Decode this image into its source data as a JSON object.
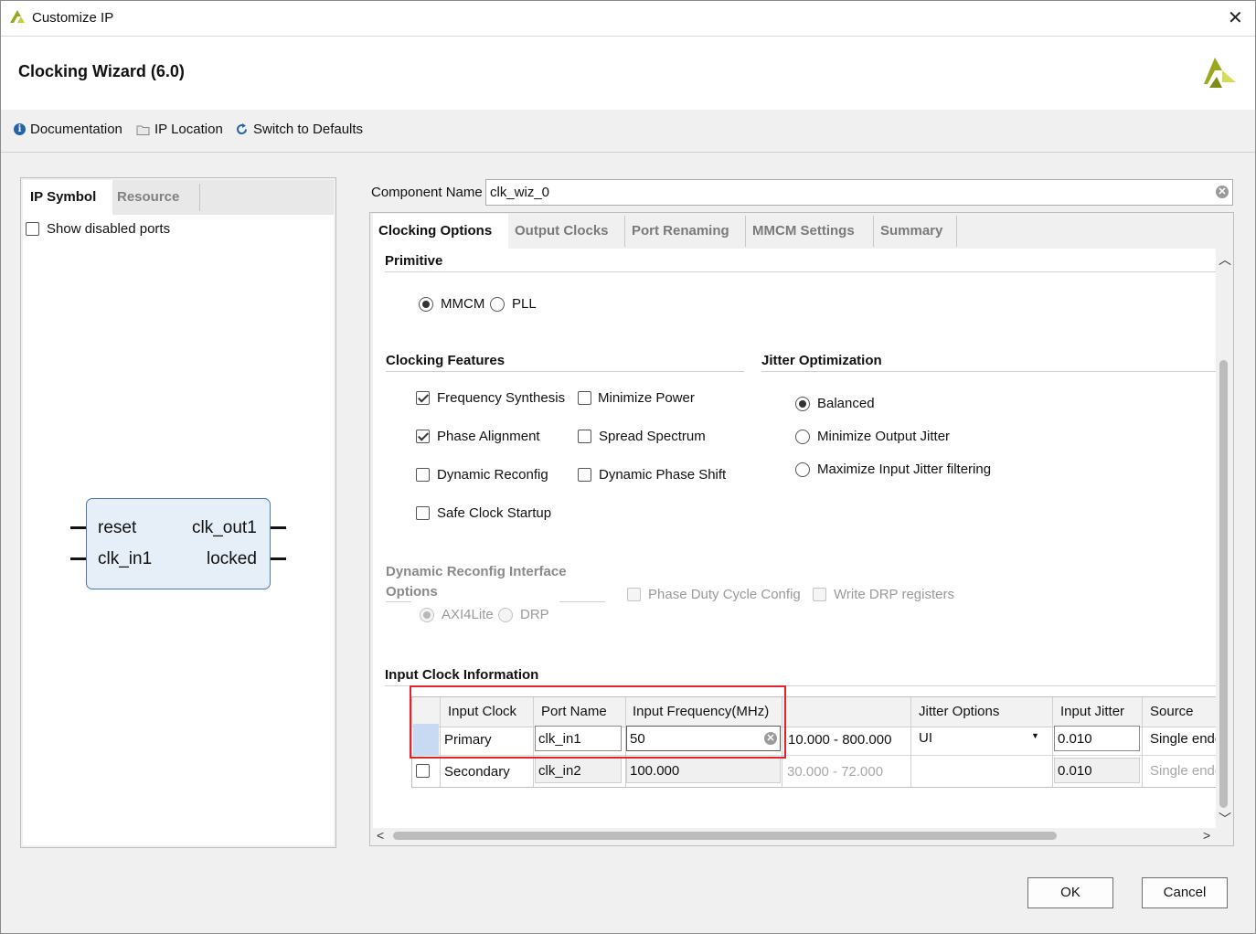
{
  "window": {
    "title": "Customize IP",
    "close_glyph": "✕"
  },
  "header": {
    "title": "Clocking Wizard (6.0)",
    "logo_icon": "xilinx-logo"
  },
  "toolbar": {
    "documentation": "Documentation",
    "ip_location": "IP Location",
    "switch_defaults": "Switch to Defaults"
  },
  "left_panel": {
    "tabs": [
      "IP Symbol",
      "Resource"
    ],
    "show_disabled_ports": "Show disabled ports",
    "symbol": {
      "ports_left": [
        "reset",
        "clk_in1"
      ],
      "ports_right": [
        "clk_out1",
        "locked"
      ]
    }
  },
  "component": {
    "label": "Component Name",
    "value": "clk_wiz_0"
  },
  "tabs": [
    "Clocking Options",
    "Output Clocks",
    "Port Renaming",
    "MMCM Settings",
    "Summary"
  ],
  "primitive": {
    "title": "Primitive",
    "options": [
      "MMCM",
      "PLL"
    ],
    "selected": "MMCM"
  },
  "clocking_features": {
    "title": "Clocking Features",
    "items": [
      {
        "label": "Frequency Synthesis",
        "checked": true
      },
      {
        "label": "Minimize Power",
        "checked": false
      },
      {
        "label": "Phase Alignment",
        "checked": true
      },
      {
        "label": "Spread Spectrum",
        "checked": false
      },
      {
        "label": "Dynamic Reconfig",
        "checked": false
      },
      {
        "label": "Dynamic Phase Shift",
        "checked": false
      },
      {
        "label": "Safe Clock Startup",
        "checked": false
      }
    ]
  },
  "jitter_optimization": {
    "title": "Jitter Optimization",
    "options": [
      "Balanced",
      "Minimize Output Jitter",
      "Maximize Input Jitter filtering"
    ],
    "selected": "Balanced"
  },
  "dynamic_reconfig": {
    "title_line1": "Dynamic Reconfig Interface",
    "title_line2": "Options",
    "options": [
      "AXI4Lite",
      "DRP"
    ],
    "checks": [
      "Phase Duty Cycle Config",
      "Write DRP registers"
    ]
  },
  "input_clock": {
    "title": "Input Clock Information",
    "columns": [
      "Input Clock",
      "Port Name",
      "Input Frequency(MHz)",
      "",
      "Jitter Options",
      "Input Jitter",
      "Source"
    ],
    "rows": [
      {
        "clock": "Primary",
        "port": "clk_in1",
        "freq": "50",
        "range": "10.000 - 800.000",
        "jitter_opt": "UI",
        "jitter": "0.010",
        "source": "Single ended clock capable pin"
      },
      {
        "clock": "Secondary",
        "port": "clk_in2",
        "freq": "100.000",
        "range": "30.000 - 72.000",
        "jitter_opt": "",
        "jitter": "0.010",
        "source": "Single ended clock capable pin"
      }
    ]
  },
  "buttons": {
    "ok": "OK",
    "cancel": "Cancel"
  }
}
